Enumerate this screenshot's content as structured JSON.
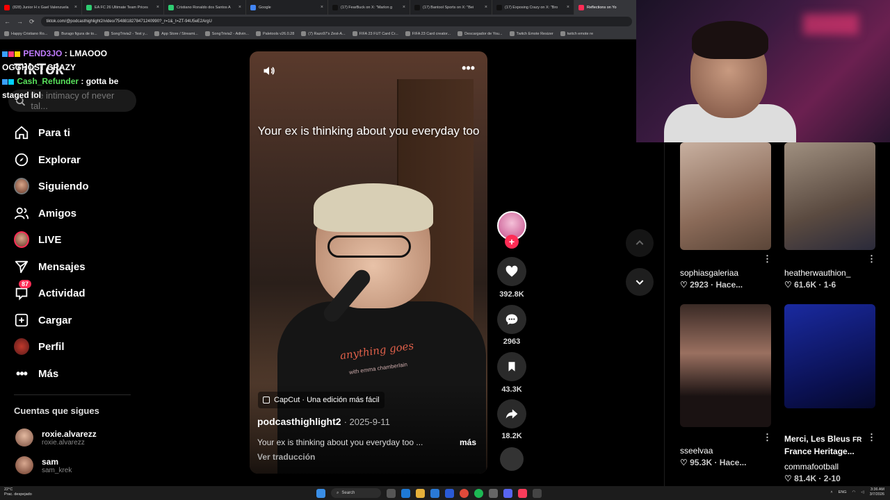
{
  "browser": {
    "tabs": [
      {
        "title": "(828) Junior H x Gael Valenzuela",
        "active": false,
        "color": "#ff0000"
      },
      {
        "title": "EA FC 26 Ultimate Team Prices",
        "active": false,
        "color": "#2ecc71"
      },
      {
        "title": "Cristiano Ronaldo dos Santos A",
        "active": false,
        "color": "#2ecc71"
      },
      {
        "title": "Google",
        "active": false,
        "color": "#4285f4"
      },
      {
        "title": "(17) FearBuck on X: \"Marlon g",
        "active": false,
        "color": "#111111"
      },
      {
        "title": "(17) Bantool Sports on X: \"Bei",
        "active": false,
        "color": "#111111"
      },
      {
        "title": "(17) Exposing Crazy on X: \"Bro",
        "active": false,
        "color": "#111111"
      },
      {
        "title": "Reflections on Yo",
        "active": true,
        "color": "#fe2c55"
      }
    ],
    "url": "tiktok.com/@podcasthighlight2/video/7548818278471240990?_r=1&_t=ZT-94U5eE2ArgU",
    "bookmarks": [
      "Happy Cristiano Ro...",
      "Burago figura de to...",
      "SongTrivia2 - Test y...",
      "App Store / Streami...",
      "SongTrivia2 - Adivin...",
      "Paletools v26.0.28",
      "(7) Razo97's Zest-A...",
      "FIFA 23 FUT Card Cr...",
      "FIFA 23 Card creator...",
      "Descargador de You...",
      "Twitch Emote Resizer",
      "twitch emote re"
    ]
  },
  "sidebar": {
    "logo": "TikTok",
    "search_placeholder": "the intimacy of never tal...",
    "nav": [
      {
        "label": "Para ti",
        "icon": "home-icon"
      },
      {
        "label": "Explorar",
        "icon": "compass-icon"
      },
      {
        "label": "Siguiendo",
        "icon": "following-avatar-icon"
      },
      {
        "label": "Amigos",
        "icon": "friends-icon"
      },
      {
        "label": "LIVE",
        "icon": "live-avatar-icon"
      },
      {
        "label": "Mensajes",
        "icon": "send-icon"
      },
      {
        "label": "Actividad",
        "icon": "activity-icon",
        "badge": "87"
      },
      {
        "label": "Cargar",
        "icon": "upload-icon"
      },
      {
        "label": "Perfil",
        "icon": "profile-avatar-icon"
      },
      {
        "label": "Más",
        "icon": "more-icon"
      }
    ],
    "following_title": "Cuentas que sigues",
    "following": [
      {
        "name": "roxie.alvarezz",
        "handle": "roxie.alvarezz"
      },
      {
        "name": "sam",
        "handle": "sam_krek"
      }
    ]
  },
  "chat": [
    {
      "user": "PEND3JO",
      "message": ": LMAOOO OGGHOST CRAZY"
    },
    {
      "user": "Cash_Refunder",
      "message": ": gotta be staged lol"
    }
  ],
  "video": {
    "caption": "Your ex is thinking about you everyday too",
    "shirt_text": "anything goes",
    "shirt_sub": "with emma chamberlain",
    "capcut": "CapCut · Una edición más fácil",
    "author": "podcasthighlight2",
    "date": "· 2025-9-11",
    "description": "Your ex is thinking about you everyday too ...",
    "more": "más",
    "translate": "Ver traducción"
  },
  "actions": {
    "likes": "392.8K",
    "comments": "2963",
    "saves": "43.3K",
    "shares": "18.2K"
  },
  "related": [
    {
      "user": "sophiasgaleriaa",
      "stats": "♡ 2923 · Hace...",
      "color": "#b8a090"
    },
    {
      "user": "heatherwauthion_",
      "stats": "♡ 61.6K · 1-6",
      "color": "#8a7060"
    },
    {
      "user": "sseelvaa",
      "stats": "♡ 95.3K · Hace...",
      "color": "#6a5040"
    },
    {
      "title": "Merci, Les Bleus",
      "tag": "FR",
      "title2": "France Heritage...",
      "user": "commafootball",
      "stats": "♡ 81.4K · 2-10",
      "color": "#1a2a8a"
    }
  ],
  "taskbar": {
    "weather_temp": "22°C",
    "weather_desc": "Prac. despejado",
    "search": "Search",
    "lang": "ENG",
    "time": "3:36 AM",
    "date": "3/7/2026"
  }
}
